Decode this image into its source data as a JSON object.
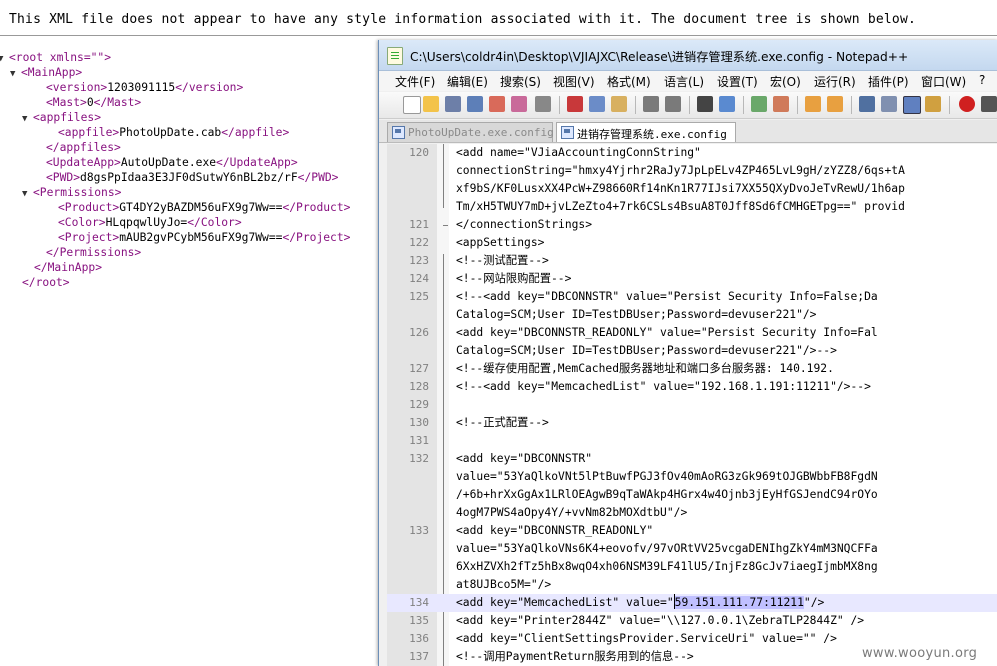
{
  "browser": {
    "notice": "This XML file does not appear to have any style information associated with it. The document tree is shown below."
  },
  "xml_tree": [
    {
      "tri": "▼",
      "open": "<root xmlns=\"\">",
      "text": "",
      "close": ""
    },
    {
      "tri": "▼",
      "open": "<MainApp>",
      "text": "",
      "close": ""
    },
    {
      "tri": "",
      "open": "<version>",
      "text": "1203091115",
      "close": "</version>"
    },
    {
      "tri": "",
      "open": "<Mast>",
      "text": "0",
      "close": "</Mast>"
    },
    {
      "tri": "▼",
      "open": "<appfiles>",
      "text": "",
      "close": ""
    },
    {
      "tri": "",
      "open": "<appfile>",
      "text": "PhotoUpDate.cab",
      "close": "</appfile>"
    },
    {
      "tri": "",
      "open": "</appfiles>",
      "text": "",
      "close": ""
    },
    {
      "tri": "",
      "open": "<UpdateApp>",
      "text": "AutoUpDate.exe",
      "close": "</UpdateApp>"
    },
    {
      "tri": "",
      "open": "<PWD>",
      "text": "d8gsPpIdaa3E3JF0dSutwY6nBL2bz/rF",
      "close": "</PWD>"
    },
    {
      "tri": "▼",
      "open": "<Permissions>",
      "text": "",
      "close": ""
    },
    {
      "tri": "",
      "open": "<Product>",
      "text": "GT4DY2yBAZDM56uFX9g7Ww==",
      "close": "</Product>"
    },
    {
      "tri": "",
      "open": "<Color>",
      "text": "HLqpqwlUyJo=",
      "close": "</Color>"
    },
    {
      "tri": "",
      "open": "<Project>",
      "text": "mAUB2gvPCybM56uFX9g7Ww==",
      "close": "</Project>"
    },
    {
      "tri": "",
      "open": "</Permissions>",
      "text": "",
      "close": ""
    },
    {
      "tri": "",
      "open": "</MainApp>",
      "text": "",
      "close": ""
    },
    {
      "tri": "",
      "open": "</root>",
      "text": "",
      "close": ""
    }
  ],
  "notepad": {
    "title": "C:\\Users\\coldr4in\\Desktop\\VJIAJXC\\Release\\进销存管理系统.exe.config - Notepad++",
    "menu": [
      "文件(F)",
      "编辑(E)",
      "搜索(S)",
      "视图(V)",
      "格式(M)",
      "语言(L)",
      "设置(T)",
      "宏(O)",
      "运行(R)",
      "插件(P)",
      "窗口(W)",
      "?"
    ],
    "tabs": [
      {
        "label": "PhotoUpDate.exe.config",
        "active": false
      },
      {
        "label": "进销存管理系统.exe.config",
        "active": true
      }
    ],
    "selected_text": "59.151.111.77:11211",
    "lines": [
      {
        "num": "120",
        "text": "  <add name=\"VJiaAccountingConnString\""
      },
      {
        "num": "",
        "text": "  connectionString=\"hmxy4Yjrhr2RaJy7JpLpELv4ZP465LvL9gH/zYZZ8/6qs+tA"
      },
      {
        "num": "",
        "text": "  xf9bS/KF0LusxXX4PcW+Z98660Rf14nKn1R77IJsi7XX55QXyDvoJeTvRewU/1h6ap"
      },
      {
        "num": "",
        "text": "  Tm/xH5TWUY7mD+jvLZeZto4+7rk6CSLs4BsuA8T0Jff8Sd6fCMHGETpg==\" provid"
      },
      {
        "num": "121",
        "text": "</connectionStrings>"
      },
      {
        "num": "122",
        "text": "<appSettings>"
      },
      {
        "num": "123",
        "text": "      <!--测试配置-->"
      },
      {
        "num": "124",
        "text": "      <!--网站限购配置-->"
      },
      {
        "num": "125",
        "text": "      <!--<add key=\"DBCONNSTR\" value=\"Persist Security Info=False;Da"
      },
      {
        "num": "",
        "text": "      Catalog=SCM;User ID=TestDBUser;Password=devuser221\"/>"
      },
      {
        "num": "126",
        "text": "      <add key=\"DBCONNSTR_READONLY\" value=\"Persist Security Info=Fal"
      },
      {
        "num": "",
        "text": "      Catalog=SCM;User ID=TestDBUser;Password=devuser221\"/>-->"
      },
      {
        "num": "127",
        "text": "      <!--缓存使用配置,MemCached服务器地址和端口多台服务器: 140.192."
      },
      {
        "num": "128",
        "text": "      <!--<add key=\"MemcachedList\" value=\"192.168.1.191:11211\"/>-->"
      },
      {
        "num": "129",
        "text": ""
      },
      {
        "num": "130",
        "text": "      <!--正式配置-->"
      },
      {
        "num": "131",
        "text": ""
      },
      {
        "num": "132",
        "text": "      <add key=\"DBCONNSTR\""
      },
      {
        "num": "",
        "text": "      value=\"53YaQlkoVNt5lPtBuwfPGJ3fOv40mAoRG3zGk969tOJGBWbbFB8FgdN"
      },
      {
        "num": "",
        "text": "      /+6b+hrXxGgAx1LRlOEAgwB9qTaWAkp4HGrx4w4Ojnb3jEyHfGSJendC94rOYo"
      },
      {
        "num": "",
        "text": "      4ogM7PWS4aOpy4Y/+vvNm82bMOXdtbU\"/>"
      },
      {
        "num": "133",
        "text": "      <add key=\"DBCONNSTR_READONLY\""
      },
      {
        "num": "",
        "text": "      value=\"53YaQlkoVNs6K4+eovofv/97vORtVV25vcgaDENIhgZkY4mM3NQCFFa"
      },
      {
        "num": "",
        "text": "      6XxHZVXh2fTz5hBx8wqO4xh06NSM39LF41lU5/InjFz8GcJv7iaegIjmbMX8ng"
      },
      {
        "num": "",
        "text": "      at8UJBco5M=\"/>"
      },
      {
        "num": "134",
        "text": "      <add key=\"MemcachedList\" value=\""
      },
      {
        "num": "135",
        "text": "  <add key=\"Printer2844Z\" value=\"\\\\127.0.0.1\\ZebraTLP2844Z\" />"
      },
      {
        "num": "136",
        "text": "  <add key=\"ClientSettingsProvider.ServiceUri\" value=\"\" />"
      },
      {
        "num": "137",
        "text": "  <!--调用PaymentReturn服务用到的信息-->"
      }
    ],
    "selected_line_tail": "\"/>"
  },
  "watermark": "www.wooyun.org",
  "colors": {
    "xml_tag": "#881280",
    "gutter": "#e4e4e4",
    "selection": "#c0c0ff",
    "title_bar": "#dbe9f8"
  }
}
